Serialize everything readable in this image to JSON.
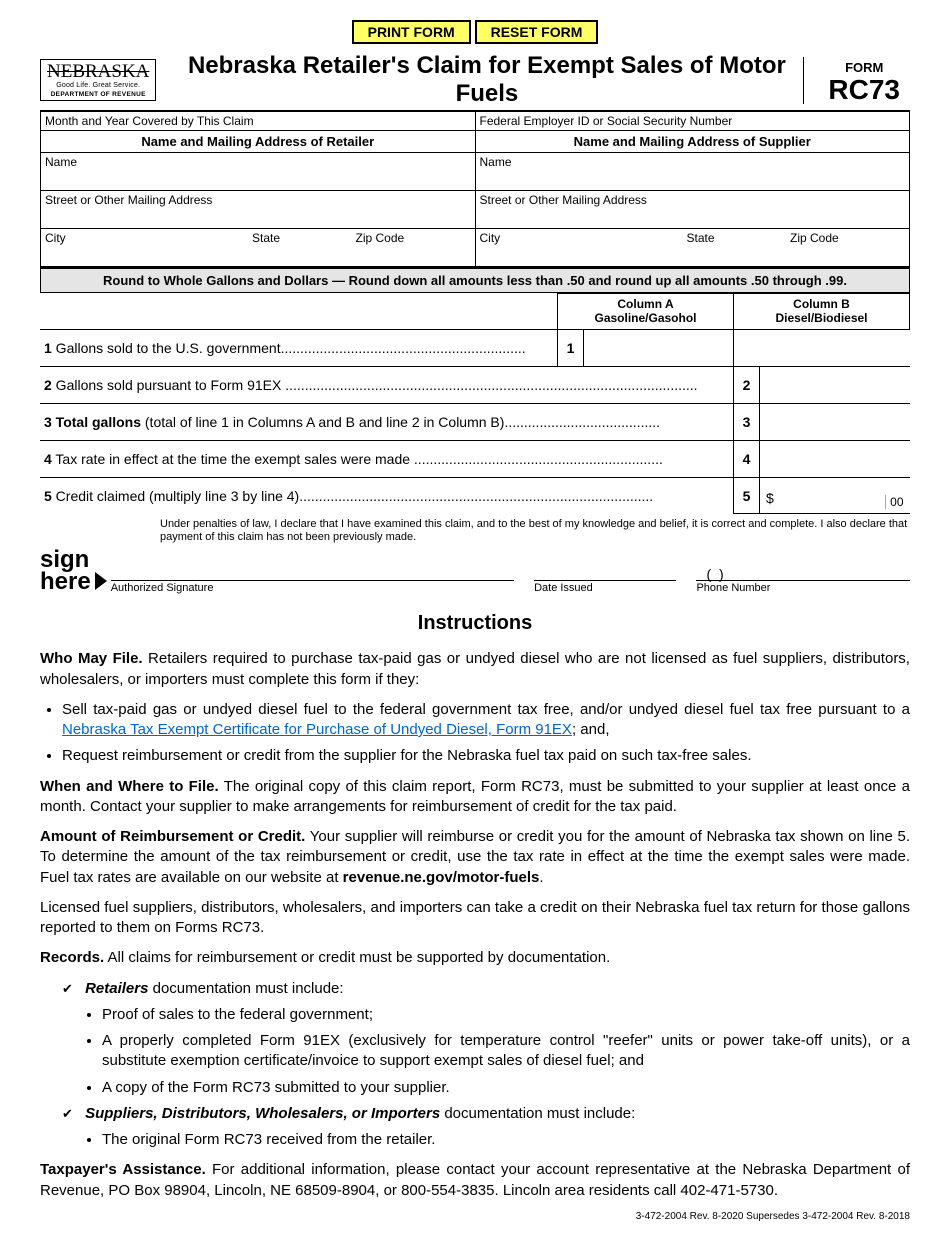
{
  "buttons": {
    "print": "PRINT FORM",
    "reset": "RESET FORM"
  },
  "logo": {
    "main": "NEBRASKA",
    "sub": "Good Life. Great Service.",
    "dept": "DEPARTMENT OF REVENUE"
  },
  "title": "Nebraska Retailer's Claim for Exempt Sales of Motor Fuels",
  "form_id": {
    "word": "FORM",
    "code": "RC73"
  },
  "top_fields": {
    "period_label": "Month and Year Covered by This Claim",
    "fein_label": "Federal Employer ID or Social Security Number"
  },
  "retailer": {
    "header": "Name and Mailing Address of Retailer",
    "name_label": "Name",
    "street_label": "Street or Other Mailing Address",
    "city_label": "City",
    "state_label": "State",
    "zip_label": "Zip Code"
  },
  "supplier": {
    "header": "Name and Mailing Address of Supplier",
    "name_label": "Name",
    "street_label": "Street or Other Mailing Address",
    "city_label": "City",
    "state_label": "State",
    "zip_label": "Zip Code"
  },
  "rounding_note": "Round to Whole Gallons and Dollars — Round down all amounts less than .50 and round up all amounts .50 through .99.",
  "columns": {
    "a_line1": "Column A",
    "a_line2": "Gasoline/Gasohol",
    "b_line1": "Column B",
    "b_line2": "Diesel/Biodiesel"
  },
  "lines": {
    "l1": {
      "num": "1",
      "text": " Gallons sold to the U.S. government",
      "box_num": "1"
    },
    "l2": {
      "num": "2",
      "text": " Gallons sold pursuant to Form 91EX ",
      "box_num": "2"
    },
    "l3": {
      "num": "3",
      "bold": " Total gallons",
      "text": " (total of line 1 in Columns A and B and line 2 in Column B)",
      "box_num": "3"
    },
    "l4": {
      "num": "4",
      "text": " Tax rate in effect at the time the exempt sales were made ",
      "box_num": "4"
    },
    "l5": {
      "num": "5",
      "text": " Credit claimed (multiply line 3 by line 4)",
      "box_num": "5",
      "currency": "$",
      "cents": "00"
    }
  },
  "declaration": "Under penalties of law, I declare that I have examined this claim, and to the best of my knowledge and belief, it is correct and complete. I also declare that payment of this claim has not been previously made.",
  "sign": {
    "sign": "sign",
    "here": "here",
    "auth_sig": "Authorized Signature",
    "date_issued": "Date Issued",
    "phone": "Phone Number",
    "parens": "(        )"
  },
  "instructions_header": "Instructions",
  "instr": {
    "who_label": "Who May File.",
    "who_text": " Retailers required to purchase tax‑paid gas or undyed diesel who are not licensed as fuel suppliers, distributors, wholesalers, or importers must complete this form if they:",
    "who_b1a": "Sell tax‑paid gas or undyed diesel fuel to the federal government tax free, and/or undyed diesel fuel tax free pursuant to a ",
    "who_b1_link": "Nebraska Tax Exempt Certificate for Purchase of Undyed Diesel, Form 91EX",
    "who_b1b": "; and,",
    "who_b2": "Request reimbursement or credit from the supplier for the Nebraska fuel tax paid on such tax‑free sales.",
    "when_label": "When and Where to File.",
    "when_text": " The original copy of this claim report, Form RC73, must be submitted to your supplier at least once a month. Contact your supplier to make arrangements for reimbursement of credit for the tax paid.",
    "amt_label": "Amount of Reimbursement or Credit.",
    "amt_text": " Your supplier will reimburse or credit you for the amount of Nebraska tax shown on line 5. To determine the amount of the tax reimbursement or credit, use the tax rate in effect at the time the exempt sales were made. Fuel tax rates are available on our website at ",
    "amt_bold": "revenue.ne.gov/motor-fuels",
    "amt_text2": ".",
    "licensed": "Licensed fuel suppliers, distributors, wholesalers, and importers can take a credit on their Nebraska fuel tax return for those gallons reported to them on Forms RC73.",
    "records_label": "Records.",
    "records_text": " All claims for reimbursement or credit must be supported by documentation.",
    "retailers_label": "Retailers",
    "retailers_text": " documentation must include:",
    "r1": "Proof of sales to the federal government;",
    "r2": "A properly completed Form 91EX (exclusively for temperature control \"reefer\" units or power take‑off units), or a substitute exemption certificate/invoice to support exempt sales of diesel fuel; and",
    "r3": "A copy of the Form RC73 submitted to your supplier.",
    "suppliers_label": "Suppliers, Distributors, Wholesalers, or Importers",
    "suppliers_text": " documentation must include:",
    "s1": "The original Form RC73 received from the retailer.",
    "tax_label": "Taxpayer's Assistance.",
    "tax_text": " For additional information, please contact your account representative at the Nebraska Department of Revenue, PO Box 98904, Lincoln, NE 68509‑8904, or 800‑554‑3835. Lincoln area residents call 402‑471‑5730."
  },
  "footer": "3‑472‑2004 Rev. 8‑2020 Supersedes 3‑472‑2004 Rev. 8‑2018"
}
